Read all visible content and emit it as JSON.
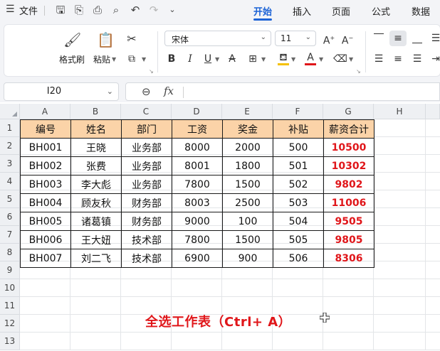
{
  "menubar": {
    "file_label": "文件",
    "tabs": [
      {
        "label": "开始",
        "active": true
      },
      {
        "label": "插入",
        "active": false
      },
      {
        "label": "页面",
        "active": false
      },
      {
        "label": "公式",
        "active": false
      },
      {
        "label": "数据",
        "active": false
      }
    ],
    "accent_color": "#1d63d6"
  },
  "ribbon": {
    "format_painter_label": "格式刷",
    "paste_label": "粘贴",
    "font_name": "宋体",
    "font_size": "11",
    "font_color": "#e0161a",
    "fill_color": "#f5c000"
  },
  "formula_bar": {
    "name_box": "I20",
    "fx_label": "fx",
    "formula": ""
  },
  "sheet": {
    "columns": [
      "A",
      "B",
      "C",
      "D",
      "E",
      "F",
      "G",
      "H"
    ],
    "rows": [
      "1",
      "2",
      "3",
      "4",
      "5",
      "6",
      "7",
      "8",
      "9",
      "10",
      "11",
      "12",
      "13"
    ],
    "header_fill": "#fbd3a8",
    "table": {
      "headers": [
        "编号",
        "姓名",
        "部门",
        "工资",
        "奖金",
        "补贴",
        "薪资合计"
      ],
      "rows": [
        [
          "BH001",
          "王晓",
          "业务部",
          "8000",
          "2000",
          "500",
          "10500"
        ],
        [
          "BH002",
          "张费",
          "业务部",
          "8001",
          "1800",
          "501",
          "10302"
        ],
        [
          "BH003",
          "李大彪",
          "业务部",
          "7800",
          "1500",
          "502",
          "9802"
        ],
        [
          "BH004",
          "顾友秋",
          "财务部",
          "8003",
          "2500",
          "503",
          "11006"
        ],
        [
          "BH005",
          "诸葛镇",
          "财务部",
          "9000",
          "100",
          "504",
          "9505"
        ],
        [
          "BH006",
          "王大妞",
          "技术部",
          "7800",
          "1500",
          "505",
          "9805"
        ],
        [
          "BH007",
          "刘二飞",
          "技术部",
          "6900",
          "900",
          "506",
          "8306"
        ]
      ]
    }
  },
  "caption": "全选工作表（Ctrl+ A）"
}
